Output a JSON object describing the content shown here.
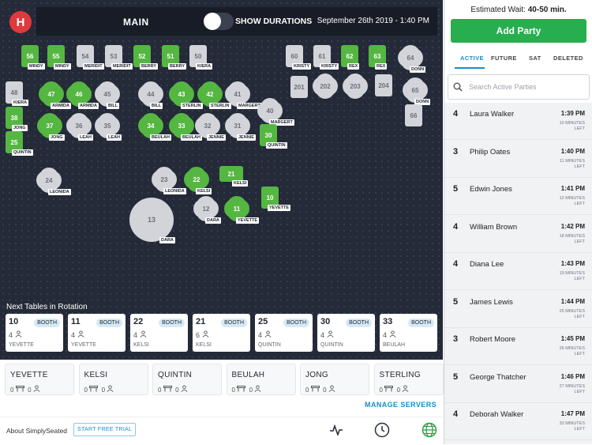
{
  "app": {
    "logo_text": "H",
    "main_label": "MAIN",
    "show_durations_label": "SHOW DURATIONS",
    "date": "September 26th 2019 - 1:40 PM"
  },
  "tables": [
    {
      "n": "56",
      "c": "g",
      "lab": "MINDY"
    },
    {
      "n": "55",
      "c": "g",
      "lab": "MINDY"
    },
    {
      "n": "54",
      "c": "w",
      "lab": "MERIDIT"
    },
    {
      "n": "53",
      "c": "w",
      "lab": "MERIDIT"
    },
    {
      "n": "52",
      "c": "g",
      "lab": "BERRY"
    },
    {
      "n": "51",
      "c": "g",
      "lab": "BERRY"
    },
    {
      "n": "50",
      "c": "w",
      "lab": "KIERA"
    },
    {
      "n": "60",
      "c": "w",
      "lab": "KRISTY"
    },
    {
      "n": "61",
      "c": "w",
      "lab": "KRISTY"
    },
    {
      "n": "62",
      "c": "g",
      "lab": "REX"
    },
    {
      "n": "63",
      "c": "g",
      "lab": "REX"
    },
    {
      "n": "64",
      "c": "w",
      "lab": "DONN"
    },
    {
      "n": "48",
      "c": "w",
      "lab": "KIERA"
    },
    {
      "n": "47",
      "c": "g",
      "lab": "ARMIDA"
    },
    {
      "n": "46",
      "c": "g",
      "lab": "ARMIDA"
    },
    {
      "n": "45",
      "c": "w",
      "lab": "BILL"
    },
    {
      "n": "44",
      "c": "w",
      "lab": "BILL"
    },
    {
      "n": "43",
      "c": "g",
      "lab": "STERLIN"
    },
    {
      "n": "42",
      "c": "g",
      "lab": "STERLIN"
    },
    {
      "n": "41",
      "c": "w",
      "lab": "MARGERT"
    },
    {
      "n": "201",
      "c": "w",
      "lab": ""
    },
    {
      "n": "202",
      "c": "w",
      "lab": ""
    },
    {
      "n": "203",
      "c": "w",
      "lab": ""
    },
    {
      "n": "204",
      "c": "w",
      "lab": ""
    },
    {
      "n": "65",
      "c": "w",
      "lab": "DONN"
    },
    {
      "n": "40",
      "c": "w",
      "lab": "MARGERT"
    },
    {
      "n": "66",
      "c": "w",
      "lab": ""
    },
    {
      "n": "38",
      "c": "g",
      "lab": "JONG"
    },
    {
      "n": "37",
      "c": "g",
      "lab": "JONG"
    },
    {
      "n": "36",
      "c": "w",
      "lab": "LEAH"
    },
    {
      "n": "35",
      "c": "w",
      "lab": "LEAH"
    },
    {
      "n": "34",
      "c": "g",
      "lab": "BEULAH"
    },
    {
      "n": "33",
      "c": "g",
      "lab": "BEULAH"
    },
    {
      "n": "32",
      "c": "w",
      "lab": "JENNIE"
    },
    {
      "n": "31",
      "c": "w",
      "lab": "JENNIE"
    },
    {
      "n": "30",
      "c": "g",
      "lab": "QUINTIN"
    },
    {
      "n": "25",
      "c": "g",
      "lab": "QUINTIN"
    },
    {
      "n": "24",
      "c": "w",
      "lab": "LEONIDA"
    },
    {
      "n": "23",
      "c": "w",
      "lab": "LEONIDA"
    },
    {
      "n": "22",
      "c": "g",
      "lab": "KELSI"
    },
    {
      "n": "21",
      "c": "g",
      "lab": "KELSI"
    },
    {
      "n": "10",
      "c": "g",
      "lab": "YEVETTE"
    },
    {
      "n": "12",
      "c": "w",
      "lab": "DARA"
    },
    {
      "n": "11",
      "c": "g",
      "lab": "YEVETTE"
    },
    {
      "n": "13",
      "c": "w",
      "lab": "DARA"
    }
  ],
  "rotation": {
    "title": "Next Tables in Rotation",
    "cards": [
      {
        "num": "10",
        "type": "BOOTH",
        "cap": "4",
        "server": "YEVETTE"
      },
      {
        "num": "11",
        "type": "BOOTH",
        "cap": "4",
        "server": "YEVETTE"
      },
      {
        "num": "22",
        "type": "BOOTH",
        "cap": "4",
        "server": "KELSI"
      },
      {
        "num": "21",
        "type": "BOOTH",
        "cap": "6",
        "server": "KELSI"
      },
      {
        "num": "25",
        "type": "BOOTH",
        "cap": "4",
        "server": "QUINTIN"
      },
      {
        "num": "30",
        "type": "BOOTH",
        "cap": "4",
        "server": "QUINTIN"
      },
      {
        "num": "33",
        "type": "BOOTH",
        "cap": "4",
        "server": "BEULAH"
      }
    ]
  },
  "servers": {
    "list": [
      {
        "name": "YEVETTE",
        "tables": "0",
        "guests": "0"
      },
      {
        "name": "KELSI",
        "tables": "0",
        "guests": "0"
      },
      {
        "name": "QUINTIN",
        "tables": "0",
        "guests": "0"
      },
      {
        "name": "BEULAH",
        "tables": "0",
        "guests": "0"
      },
      {
        "name": "JONG",
        "tables": "0",
        "guests": "0"
      },
      {
        "name": "STERLING",
        "tables": "0",
        "guests": "0"
      }
    ],
    "manage_label": "MANAGE SERVERS"
  },
  "footer": {
    "about": "About SimplySeated",
    "trial": "START FREE TRIAL",
    "icons": [
      "activity-icon",
      "clock-icon",
      "globe-icon"
    ]
  },
  "sidebar": {
    "wait_prefix": "Estimated Wait: ",
    "wait_value": "40-50 min.",
    "add_party": "Add Party",
    "tabs": [
      "ACTIVE",
      "FUTURE",
      "SAT",
      "DELETED"
    ],
    "search_placeholder": "Search Active Parties",
    "parties": [
      {
        "size": "4",
        "name": "Laura Walker",
        "time": "1:39 PM",
        "min": "10 MINUTES",
        "left": "LEFT"
      },
      {
        "size": "3",
        "name": "Philip Oates",
        "time": "1:40 PM",
        "min": "11 MINUTES",
        "left": "LEFT"
      },
      {
        "size": "5",
        "name": "Edwin Jones",
        "time": "1:41 PM",
        "min": "12 MINUTES",
        "left": "LEFT"
      },
      {
        "size": "4",
        "name": "William Brown",
        "time": "1:42 PM",
        "min": "18 MINUTES",
        "left": "LEFT"
      },
      {
        "size": "4",
        "name": "Diana Lee",
        "time": "1:43 PM",
        "min": "19 MINUTES",
        "left": "LEFT"
      },
      {
        "size": "5",
        "name": "James Lewis",
        "time": "1:44 PM",
        "min": "25 MINUTES",
        "left": "LEFT"
      },
      {
        "size": "3",
        "name": "Robert Moore",
        "time": "1:45 PM",
        "min": "26 MINUTES",
        "left": "LEFT"
      },
      {
        "size": "5",
        "name": "George Thatcher",
        "time": "1:46 PM",
        "min": "27 MINUTES",
        "left": "LEFT"
      },
      {
        "size": "4",
        "name": "Deborah Walker",
        "time": "1:47 PM",
        "min": "33 MINUTES",
        "left": "LEFT"
      }
    ]
  },
  "colors": {
    "floor": "#242a38",
    "occupied": "#55b642",
    "free": "#d2d4d9",
    "accent": "#1a8cc9",
    "add_button": "#27ae4f"
  }
}
